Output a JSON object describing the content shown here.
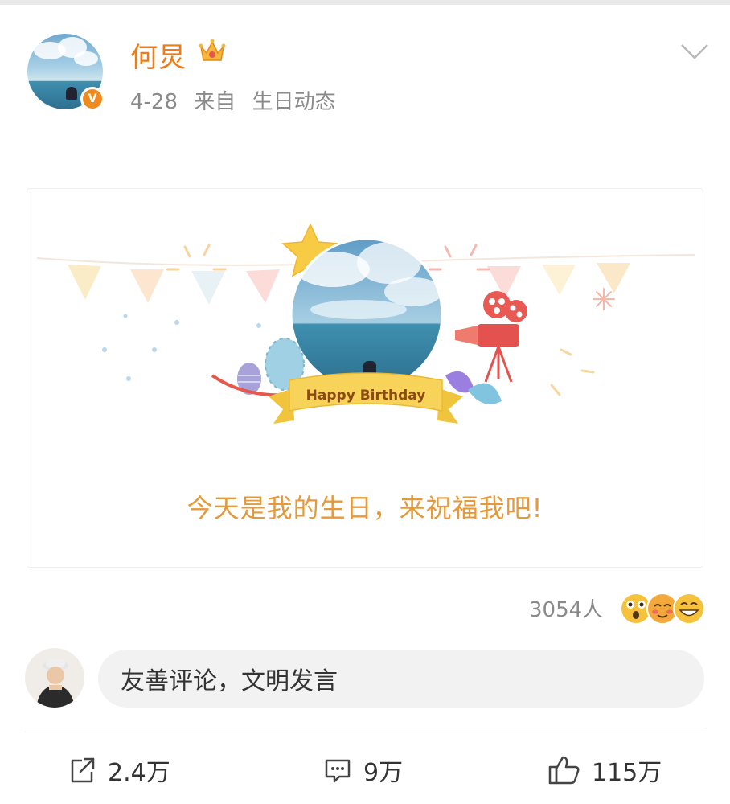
{
  "post": {
    "author": "何炅",
    "date": "4-28",
    "source_prefix": "来自",
    "source": "生日动态",
    "verified_badge": "V",
    "icons": {
      "crown": "crown-icon",
      "menu": "chevron-down-icon"
    }
  },
  "birthday_card": {
    "banner": "Happy Birthday",
    "caption": "今天是我的生日，来祝福我吧!"
  },
  "reactions": {
    "count": "3054人",
    "emoji_icons": [
      "shocked-emoji-icon",
      "blush-emoji-icon",
      "grin-emoji-icon"
    ]
  },
  "comment": {
    "placeholder": "友善评论，文明发言"
  },
  "actions": {
    "share_count": "2.4万",
    "comment_count": "9万",
    "like_count": "115万"
  },
  "colors": {
    "username": "#f07a16",
    "caption": "#e49a3b",
    "badge": "#f08a1f",
    "text_muted": "#8a8a8a"
  }
}
